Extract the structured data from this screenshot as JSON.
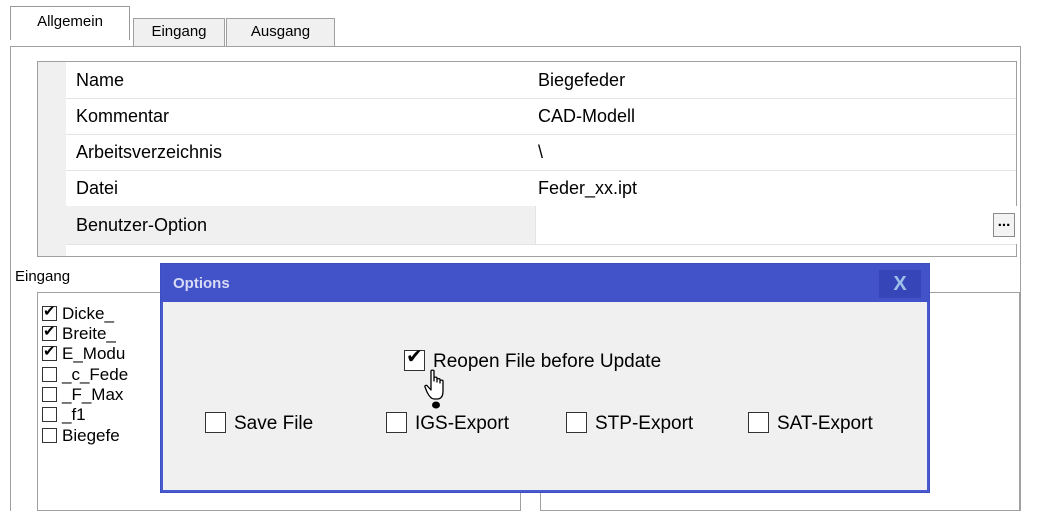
{
  "tabs": [
    {
      "label": "Allgemein",
      "active": true
    },
    {
      "label": "Eingang",
      "active": false
    },
    {
      "label": "Ausgang",
      "active": false
    }
  ],
  "properties": [
    {
      "name": "Name",
      "value": "Biegefeder"
    },
    {
      "name": "Kommentar",
      "value": "CAD-Modell"
    },
    {
      "name": "Arbeitsverzeichnis",
      "value": "\\"
    },
    {
      "name": "Datei",
      "value": "Feder_xx.ipt"
    },
    {
      "name": "Benutzer-Option",
      "value": "",
      "button_label": "..."
    }
  ],
  "eingang": {
    "label": "Eingang",
    "items": [
      {
        "label": "Dicke_",
        "checked": true
      },
      {
        "label": "Breite_",
        "checked": true
      },
      {
        "label": "E_Modu",
        "checked": true
      },
      {
        "label": "_c_Fede",
        "checked": false
      },
      {
        "label": "_F_Max",
        "checked": false
      },
      {
        "label": "_f1",
        "checked": false
      },
      {
        "label": "Biegefe",
        "checked": false
      }
    ]
  },
  "dialog": {
    "title": "Options",
    "close_label": "X",
    "reopen": {
      "label": "Reopen File before Update",
      "checked": true
    },
    "options": [
      {
        "label": "Save File",
        "checked": false
      },
      {
        "label": "IGS-Export",
        "checked": false
      },
      {
        "label": "STP-Export",
        "checked": false
      },
      {
        "label": "SAT-Export",
        "checked": false
      }
    ]
  },
  "colors": {
    "title_bar": "#4252c9",
    "close_button": "#3646b8",
    "background": "#f0f0f0"
  },
  "icons": {
    "cursor": "hand-pointer-icon",
    "checkbox_mark": "checkmark-icon"
  }
}
